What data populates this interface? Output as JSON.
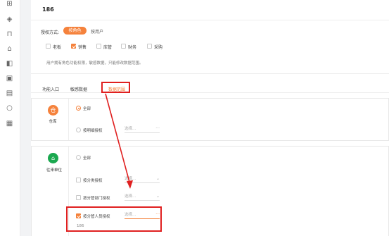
{
  "sidebar": {
    "icons": [
      "grid-icon",
      "compass-icon",
      "briefcase-icon",
      "home-icon",
      "lock-icon",
      "clipboard-icon",
      "id-card-icon",
      "loop-icon",
      "document-icon"
    ]
  },
  "page": {
    "title": "186"
  },
  "auth": {
    "label": "授权方式:",
    "by_role": "按角色",
    "by_user": "按用户"
  },
  "roles": [
    {
      "label": "老板",
      "checked": false
    },
    {
      "label": "销售",
      "checked": true
    },
    {
      "label": "库管",
      "checked": false
    },
    {
      "label": "财务",
      "checked": false
    },
    {
      "label": "采购",
      "checked": false
    }
  ],
  "hint": "用户拥有角色功能权限，敏感数据，只能修改数据范围。",
  "tabs": [
    "功能入口",
    "敏感数据",
    "数据范围"
  ],
  "cards": {
    "warehouse": {
      "name": "仓库",
      "avatar_glyph": "仓",
      "option_all": "全部",
      "option_by_org": "按明细授权",
      "select_placeholder": "选择..."
    },
    "partner": {
      "name": "往来单位",
      "avatar_glyph": "⌂",
      "option_all": "全部",
      "by_category": "按分类授权",
      "by_dept": "按分管部门授权",
      "by_staff": "按分管人员授权",
      "select_placeholder": "选择...",
      "staff_value": "186"
    }
  },
  "colors": {
    "accent": "#f5823c",
    "annotation": "#e02020",
    "partner_avatar": "#1aa84f"
  }
}
